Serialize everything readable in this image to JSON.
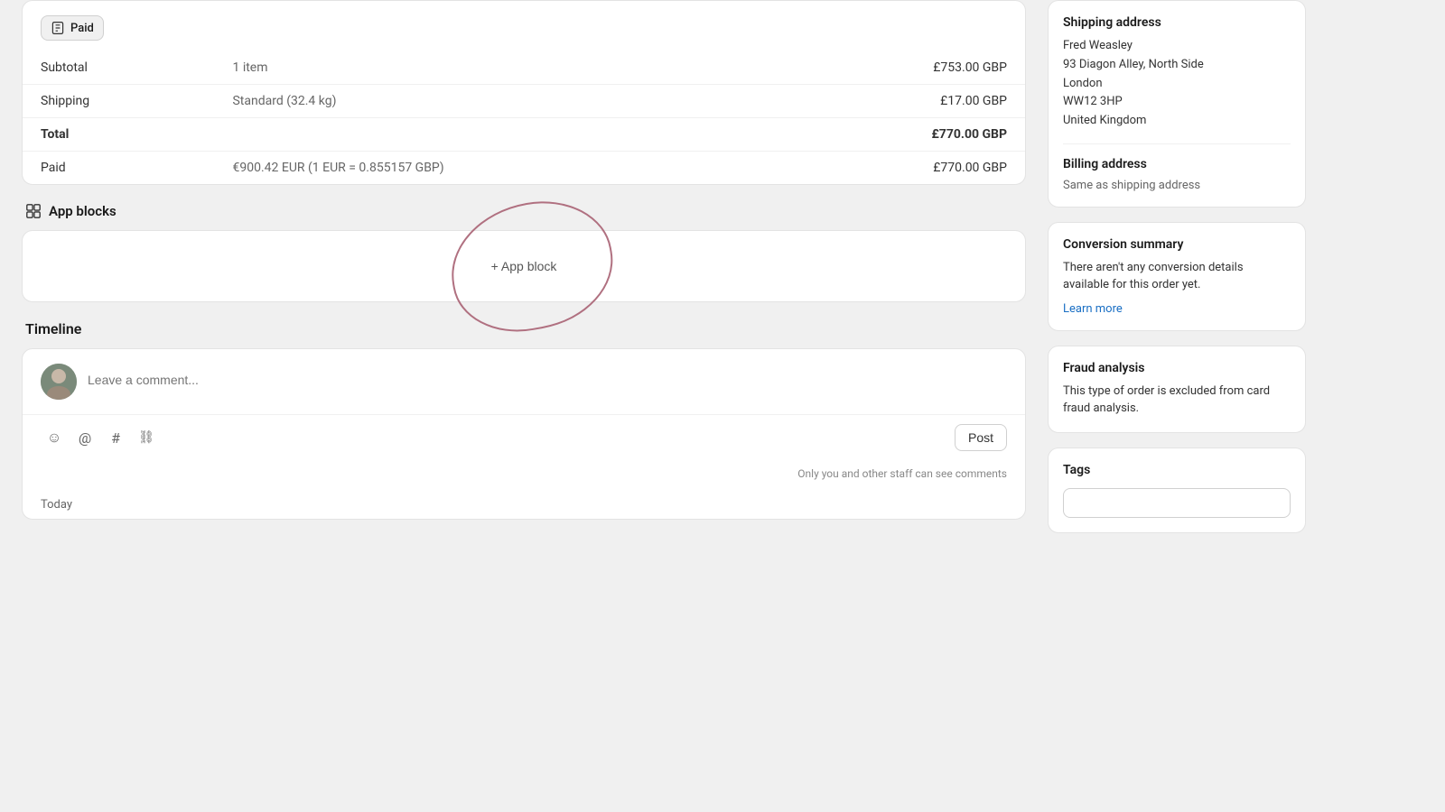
{
  "payment": {
    "badge_label": "Paid",
    "subtotal_label": "Subtotal",
    "subtotal_desc": "1 item",
    "subtotal_amount": "£753.00 GBP",
    "shipping_label": "Shipping",
    "shipping_desc": "Standard (32.4 kg)",
    "shipping_amount": "£17.00 GBP",
    "total_label": "Total",
    "total_amount": "£770.00 GBP",
    "paid_label": "Paid",
    "paid_desc": "€900.42 EUR (1 EUR = 0.855157 GBP)",
    "paid_amount": "£770.00 GBP"
  },
  "app_blocks": {
    "section_title": "App blocks",
    "add_block_label": "+ App block"
  },
  "timeline": {
    "section_title": "Timeline",
    "comment_placeholder": "Leave a comment...",
    "post_button": "Post",
    "staff_note": "Only you and other staff can see comments",
    "today_label": "Today"
  },
  "sidebar": {
    "shipping_address_title": "Shipping address",
    "shipping_name": "Fred Weasley",
    "shipping_street": "93 Diagon Alley, North Side",
    "shipping_city": "London",
    "shipping_postal": "WW12 3HP",
    "shipping_country": "United Kingdom",
    "billing_address_title": "Billing address",
    "billing_same": "Same as shipping address",
    "conversion_title": "Conversion summary",
    "conversion_text": "There aren't any conversion details available for this order yet.",
    "learn_more": "Learn more",
    "fraud_title": "Fraud analysis",
    "fraud_text": "This type of order is excluded from card fraud analysis.",
    "tags_title": "Tags",
    "tags_placeholder": ""
  },
  "icons": {
    "paid_icon": "🧾",
    "app_blocks_icon": "⊞",
    "emoji_icon": "☺",
    "mention_icon": "@",
    "hashtag_icon": "#",
    "link_icon": "🔗"
  }
}
